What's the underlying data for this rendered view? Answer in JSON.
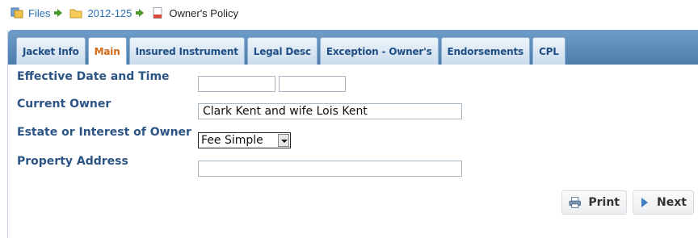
{
  "breadcrumb": {
    "items": [
      {
        "label": "Files",
        "icon": "files-icon"
      },
      {
        "label": "2012-125",
        "icon": "folder-icon"
      },
      {
        "label": "Owner's Policy",
        "icon": "document-icon"
      }
    ],
    "link_color": "#2a6fb5",
    "arrow_color": "#4a9a2e"
  },
  "tabs": [
    {
      "label": "Jacket Info",
      "active": false
    },
    {
      "label": "Main",
      "active": true
    },
    {
      "label": "Insured Instrument",
      "active": false
    },
    {
      "label": "Legal Desc",
      "active": false
    },
    {
      "label": "Exception - Owner's",
      "active": false
    },
    {
      "label": "Endorsements",
      "active": false
    },
    {
      "label": "CPL",
      "active": false
    }
  ],
  "form": {
    "effective_date_label": "Effective Date and Time",
    "effective_date_value": "",
    "effective_time_value": "",
    "current_owner_label": "Current Owner",
    "current_owner_value": "Clark Kent and wife Lois Kent",
    "estate_label": "Estate or Interest of Owner",
    "estate_value": "Fee Simple",
    "property_address_label": "Property Address",
    "property_address_value": ""
  },
  "buttons": {
    "print_label": "Print",
    "next_label": "Next"
  },
  "colors": {
    "label": "#2c5485",
    "active_tab": "#d36a18",
    "tab_text": "#1f4f86",
    "tabbar": "#5b8ab8"
  }
}
